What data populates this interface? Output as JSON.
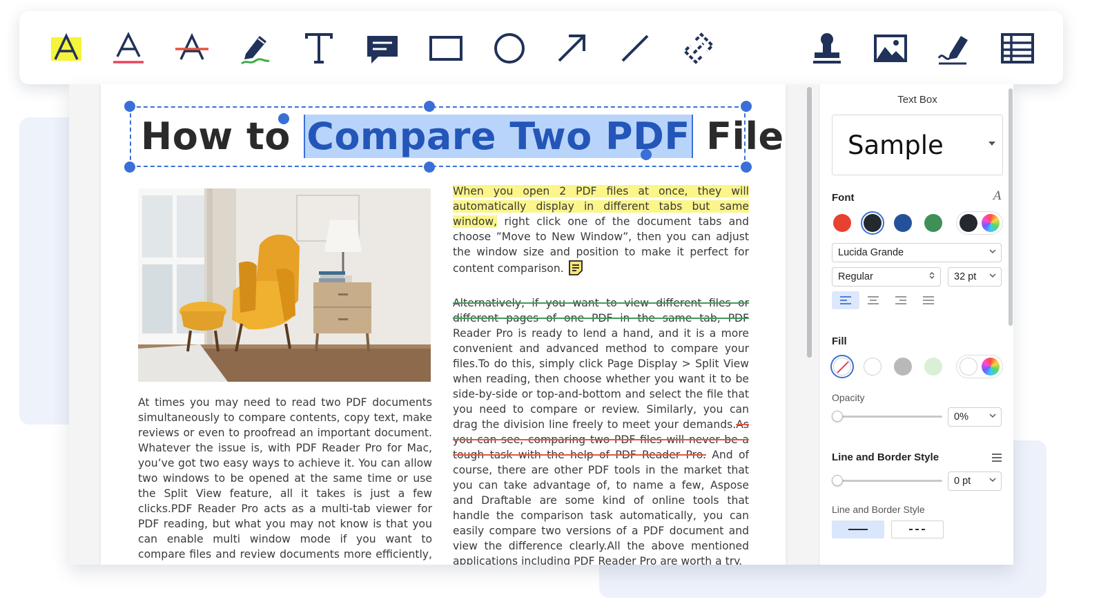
{
  "colors": {
    "accent": "#3a6fd8",
    "highlight": "#fbf58a",
    "strike_green": "#3f9a59",
    "strike_red": "#e2553f",
    "navy_icon": "#203259"
  },
  "toolbar": {
    "tools": [
      {
        "name": "highlight-tool",
        "icon": "highlighter-a-icon"
      },
      {
        "name": "underline-tool",
        "icon": "underline-a-icon"
      },
      {
        "name": "strikethrough-tool",
        "icon": "strikethrough-a-icon"
      },
      {
        "name": "freehand-tool",
        "icon": "pen-icon"
      },
      {
        "name": "text-tool",
        "icon": "text-t-icon"
      },
      {
        "name": "note-tool",
        "icon": "comment-icon"
      },
      {
        "name": "rectangle-tool",
        "icon": "rectangle-icon"
      },
      {
        "name": "oval-tool",
        "icon": "circle-icon"
      },
      {
        "name": "arrow-tool",
        "icon": "arrow-icon"
      },
      {
        "name": "line-tool",
        "icon": "line-icon"
      },
      {
        "name": "link-tool",
        "icon": "link-icon"
      },
      {
        "name": "stamp-tool",
        "icon": "stamp-icon"
      },
      {
        "name": "image-tool",
        "icon": "image-icon"
      },
      {
        "name": "signature-tool",
        "icon": "signature-icon"
      },
      {
        "name": "table-tool",
        "icon": "table-icon"
      }
    ]
  },
  "document": {
    "title_before": "How to ",
    "title_selected": "Compare Two PDF",
    "title_after": " Files",
    "left_column": "At times you may need to read two PDF documents simultaneously to compare contents, copy text, make reviews or even to proofread an important document. Whatever the issue is, with PDF Reader Pro for Mac, you’ve got two easy ways to achieve it. You can allow two windows to be opened at the same time or use the Split View feature, all it takes is just a few clicks.PDF Reader Pro acts as a multi-tab viewer for PDF reading, but what you may not know is that you can enable multi window mode if you want to compare files and review documents more efficiently, or simply read a paper as a whole of multiple paragraphs or files.",
    "right_p1_highlight": "When you open 2 PDF files at once, they will automatically display in different tabs but same window,",
    "right_p1_rest": " right click one of the document tabs and choose ”Move  to New Window”, then you can adjust the window size and position to make it perfect for content comparison.",
    "right_p2_strike_green": "Alternatively, if you want to view different files or different pages of one PDF in the same tab, PDF",
    "right_p2_mid": " Reader Pro is ready to lend a hand, and it is a more convenient and advanced method to compare your files.To do this, simply click Page Display > Split View when reading, then choose whether you want it to be side-by-side or top-and-bottom and select the file that you need to compare or review. Similarly, you can drag the division line freely to meet your demands.",
    "right_p2_strike_red": "As you can see, comparing two PDF files will never be a tough task with the help of PDF Reader Pro.",
    "right_p2_end": " And of course, there are other PDF tools in the market that you can take advantage of, to name a few, Aspose and Draftable are some kind of online tools that handle the comparison task automatically, you can easily compare two versions of a PDF document and view the difference clearly.All the above mentioned applications including PDF Reader Pro are worth a try."
  },
  "panel": {
    "title": "Text Box",
    "sample": "Sample",
    "font_label": "Font",
    "font_family": "Lucida Grande",
    "font_style": "Regular",
    "font_size": "32 pt",
    "font_colors": [
      "#e8412f",
      "#24282f",
      "#23529a",
      "#3f8f59",
      "#24282f"
    ],
    "fill_label": "Fill",
    "fill_colors": [
      "none",
      "#ffffff",
      "#b9b9bb",
      "#d9f0d4"
    ],
    "opacity_label": "Opacity",
    "opacity_value": "0%",
    "opacity_level": 0,
    "line_style_label": "Line and Border Style",
    "line_width": "0 pt",
    "line_width_level": 0,
    "line_style_sub": "Line and Border Style"
  }
}
